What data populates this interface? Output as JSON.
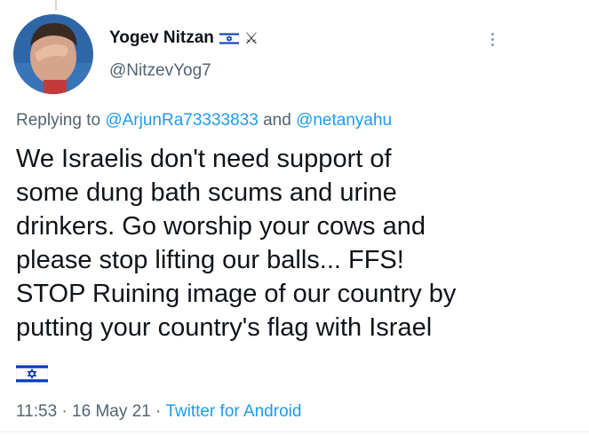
{
  "tweet": {
    "display_name": "Yogev Nitzan",
    "name_suffix_icons": [
      "israel-flag-icon",
      "crossed-swords-icon"
    ],
    "handle": "@NitzevYog7",
    "replying_prefix": "Replying to",
    "reply_to_1": "@ArjunRa73333833",
    "reply_joiner": "and",
    "reply_to_2": "@netanyahu",
    "text": "We Israelis don't need support of\nsome dung bath scums and urine\ndrinkers. Go worship your cows and\nplease stop lifting our balls... FFS!\nSTOP Ruining image of our country by\nputting your country's flag with Israel",
    "trailing_emoji": "israel-flag-icon",
    "time": "11:53",
    "date": "16 May 21",
    "separator": "·",
    "source": "Twitter for Android"
  },
  "colors": {
    "link": "#1d9bf0",
    "secondary_text": "#536471",
    "primary_text": "#0f1419",
    "flag_blue": "#0038b8"
  }
}
